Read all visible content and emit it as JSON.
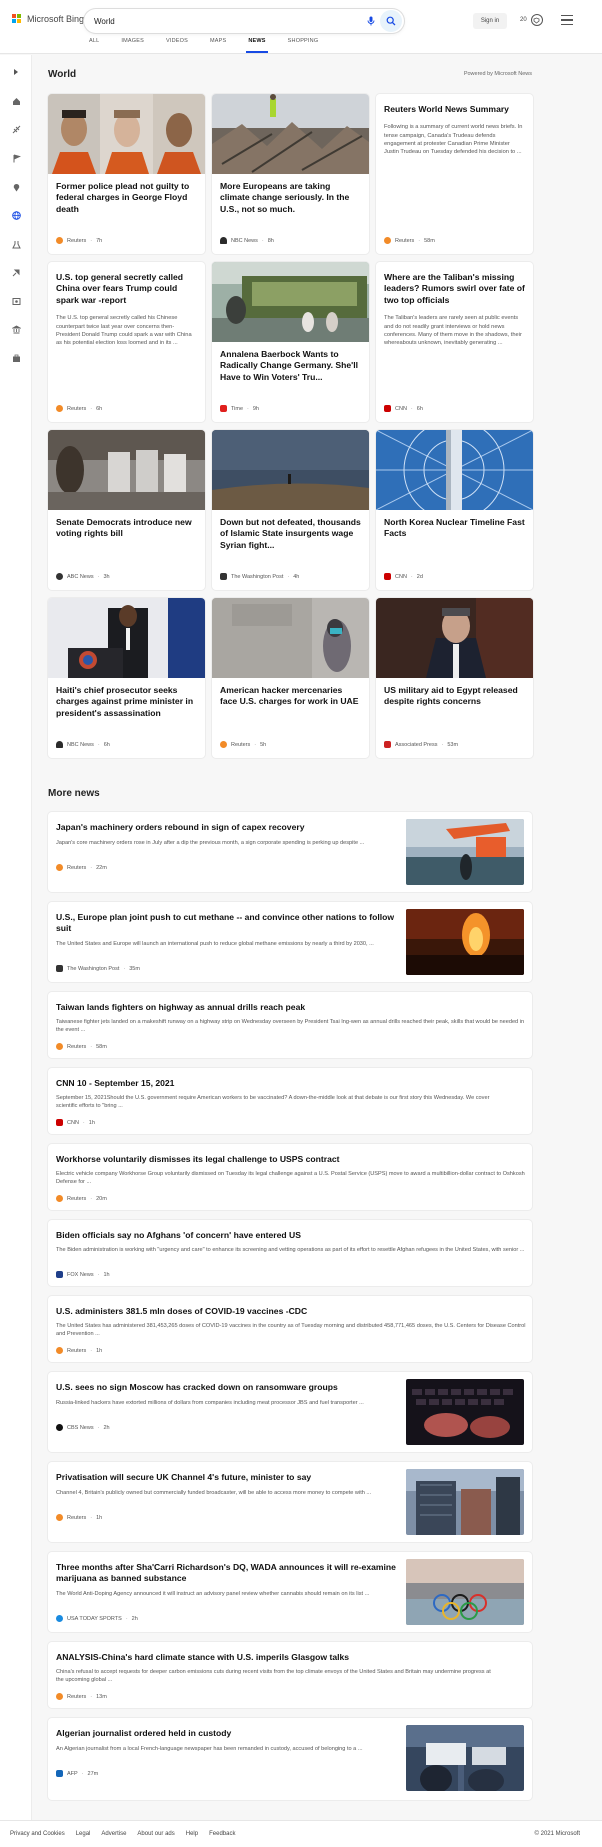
{
  "header": {
    "brand": "Microsoft Bing",
    "search_query": "World",
    "sign_in": "Sign in",
    "rewards_points": "20",
    "tabs": [
      {
        "label": "ALL"
      },
      {
        "label": "IMAGES"
      },
      {
        "label": "VIDEOS"
      },
      {
        "label": "MAPS"
      },
      {
        "label": "NEWS"
      },
      {
        "label": "SHOPPING"
      }
    ],
    "active_tab": "NEWS"
  },
  "rail": {
    "icons": [
      "expand-icon",
      "home-icon",
      "sports-icon",
      "flag-icon",
      "location-icon",
      "world-icon",
      "science-icon",
      "tech-icon",
      "entertainment-icon",
      "politics-icon",
      "business-icon"
    ],
    "active": "world-icon"
  },
  "world": {
    "title": "World",
    "powered_by": "Powered by Microsoft News",
    "cards": [
      {
        "title": "Former police plead not guilty to federal charges in George Floyd death",
        "body": "",
        "source": "Reuters",
        "time": "7h",
        "source_color": "#f28b28"
      },
      {
        "title": "More Europeans are taking climate change seriously. In the U.S., not so much.",
        "body": "",
        "source": "NBC News",
        "time": "8h",
        "source_color": "#2b2b2b"
      },
      {
        "title": "Reuters World News Summary",
        "body": "Following is a summary of current world news briefs. In tense campaign, Canada's Trudeau defends engagement at protester Canadian Prime Minister Justin Trudeau on Tuesday defended his decision to ...",
        "source": "Reuters",
        "time": "58m",
        "source_color": "#f28b28"
      },
      {
        "title": "U.S. top general secretly called China over fears Trump could spark war -report",
        "body": "The U.S. top general secretly called his Chinese counterpart twice last year over concerns then-President Donald Trump could spark a war with China as his potential election loss loomed and in its ...",
        "source": "Reuters",
        "time": "6h",
        "source_color": "#f28b28"
      },
      {
        "title": "Annalena Baerbock Wants to Radically Change Germany. She'll Have to Win Voters' Tru...",
        "body": "",
        "source": "Time",
        "time": "9h",
        "source_color": "#e0201d"
      },
      {
        "title": "Where are the Taliban's missing leaders? Rumors swirl over fate of two top officials",
        "body": "The Taliban's leaders are rarely seen at public events and do not readily grant interviews or hold news conferences. Many of them move in the shadows, their whereabouts unknown, inevitably generating ...",
        "source": "CNN",
        "time": "6h",
        "source_color": "#cc0000"
      },
      {
        "title": "Senate Democrats introduce new voting rights bill",
        "body": "",
        "source": "ABC News",
        "time": "3h",
        "source_color": "#333333"
      },
      {
        "title": "Down but not defeated, thousands of Islamic State insurgents wage Syrian fight...",
        "body": "",
        "source": "The Washington Post",
        "time": "4h",
        "source_color": "#333333"
      },
      {
        "title": "North Korea Nuclear Timeline Fast Facts",
        "body": "",
        "source": "CNN",
        "time": "2d",
        "source_color": "#cc0000"
      },
      {
        "title": "Haiti's chief prosecutor seeks charges against prime minister in president's assassination",
        "body": "",
        "source": "NBC News",
        "time": "6h",
        "source_color": "#2b2b2b"
      },
      {
        "title": "American hacker mercenaries face U.S. charges for work in UAE",
        "body": "",
        "source": "Reuters",
        "time": "5h",
        "source_color": "#f28b28"
      },
      {
        "title": "US military aid to Egypt released despite rights concerns",
        "body": "",
        "source": "Associated Press",
        "time": "53m",
        "source_color": "#cc2222"
      }
    ]
  },
  "more_news": {
    "title": "More news",
    "items": [
      {
        "title": "Japan's machinery orders rebound in sign of capex recovery",
        "body": "Japan's core machinery orders rose in July after a dip the previous month, a sign corporate spending is perking up despite ...",
        "source": "Reuters",
        "time": "22m",
        "source_color": "#f28b28"
      },
      {
        "title": "U.S., Europe plan joint push to cut methane -- and convince other nations to follow suit",
        "body": "The United States and Europe will launch an international push to reduce global methane emissions by nearly a third by 2030, ...",
        "source": "The Washington Post",
        "time": "35m",
        "source_color": "#333333"
      },
      {
        "title": "Taiwan lands fighters on highway as annual drills reach peak",
        "body": "Taiwanese fighter jets landed on a makeshift runway on a highway strip on Wednesday overseen by President Tsai Ing-wen as annual drills reached their peak, skills that would be needed in the event ...",
        "source": "Reuters",
        "time": "58m",
        "source_color": "#f28b28"
      },
      {
        "title": "CNN 10 - September 15, 2021",
        "body": "September 15, 2021Should the U.S. government require American workers to be vaccinated? A down-the-middle look at that debate is our first story this Wednesday. We cover scientific efforts to \"bring ...",
        "source": "CNN",
        "time": "1h",
        "source_color": "#cc0000"
      },
      {
        "title": "Workhorse voluntarily dismisses its legal challenge to USPS contract",
        "body": "Electric vehicle company Workhorse Group voluntarily dismissed on Tuesday its legal challenge against a U.S. Postal Service (USPS) move to award a multibillion-dollar contract to Oshkosh Defense for ...",
        "source": "Reuters",
        "time": "20m",
        "source_color": "#f28b28"
      },
      {
        "title": "Biden officials say no Afghans 'of concern' have entered US",
        "body": "The Biden administration is working with \"urgency and care\" to enhance its screening and vetting operations as part of its effort to resettle Afghan refugees in the United States, with senior ...",
        "source": "FOX News",
        "time": "1h",
        "source_color": "#1f3f8a"
      },
      {
        "title": "U.S. administers 381.5 mln doses of COVID-19 vaccines -CDC",
        "body": "The United States has administered 381,453,265 doses of COVID-19 vaccines in the country as of Tuesday morning and distributed 458,771,465 doses, the U.S. Centers for Disease Control and Prevention ...",
        "source": "Reuters",
        "time": "1h",
        "source_color": "#f28b28"
      },
      {
        "title": "U.S. sees no sign Moscow has cracked down on ransomware groups",
        "body": "Russia-linked hackers have extorted millions of dollars from companies including meat processor JBS and fuel transporter ...",
        "source": "CBS News",
        "time": "2h",
        "source_color": "#111111"
      },
      {
        "title": "Privatisation will secure UK Channel 4's future, minister to say",
        "body": "Channel 4, Britain's publicly owned but commercially funded broadcaster, will be able to access more money to compete with ...",
        "source": "Reuters",
        "time": "1h",
        "source_color": "#f28b28"
      },
      {
        "title": "Three months after Sha'Carri Richardson's DQ, WADA announces it will re-examine marijuana as banned substance",
        "body": "The World Anti-Doping Agency announced it will instruct an advisory panel review whether cannabis should remain on its list ...",
        "source": "USA TODAY SPORTS",
        "time": "2h",
        "source_color": "#1a8be0"
      },
      {
        "title": "ANALYSIS-China's hard climate stance with U.S. imperils Glasgow talks",
        "body": "China's refusal to accept requests for deeper carbon emissions cuts during recent visits from the top climate envoys of the United States and Britain may undermine progress at the upcoming global ...",
        "source": "Reuters",
        "time": "13m",
        "source_color": "#f28b28"
      },
      {
        "title": "Algerian journalist ordered held in custody",
        "body": "An Algerian journalist from a local French-language newspaper has been remanded in custody, accused of belonging to a ...",
        "source": "AFP",
        "time": "27m",
        "source_color": "#1466b8"
      }
    ]
  },
  "footer": {
    "links": [
      "Privacy and Cookies",
      "Legal",
      "Advertise",
      "About our ads",
      "Help",
      "Feedback"
    ],
    "copyright": "© 2021 Microsoft"
  },
  "colors": {
    "accent": "#174ae4",
    "bing_red": "#f25022",
    "bing_green": "#7fba00",
    "bing_blue": "#00a4ef",
    "bing_yellow": "#ffb900"
  }
}
